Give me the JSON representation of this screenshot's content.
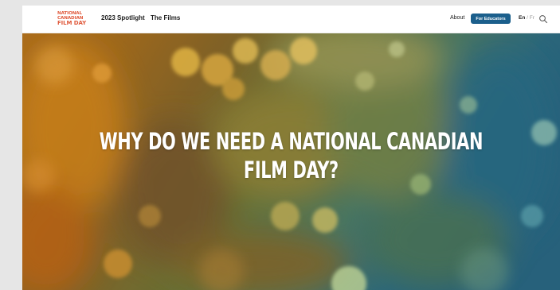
{
  "brand": {
    "logo_line1": "NATIONAL",
    "logo_line2": "CANADIAN",
    "logo_line3": "FILM DAY",
    "logo_color": "#e05a3c"
  },
  "nav": {
    "spotlight": "2023 Spotlight",
    "films": "The Films",
    "about": "About",
    "educators": "For Educators",
    "educators_color": "#1b5f8c",
    "lang_en": "En",
    "lang_sep": "/",
    "lang_fr": "Fr",
    "search_icon": "search-icon"
  },
  "hero": {
    "title_line1": "WHY DO WE NEED A NATIONAL CANADIAN",
    "title_line2": "FILM DAY?",
    "background": "blurred bokeh lights, amber to teal"
  }
}
